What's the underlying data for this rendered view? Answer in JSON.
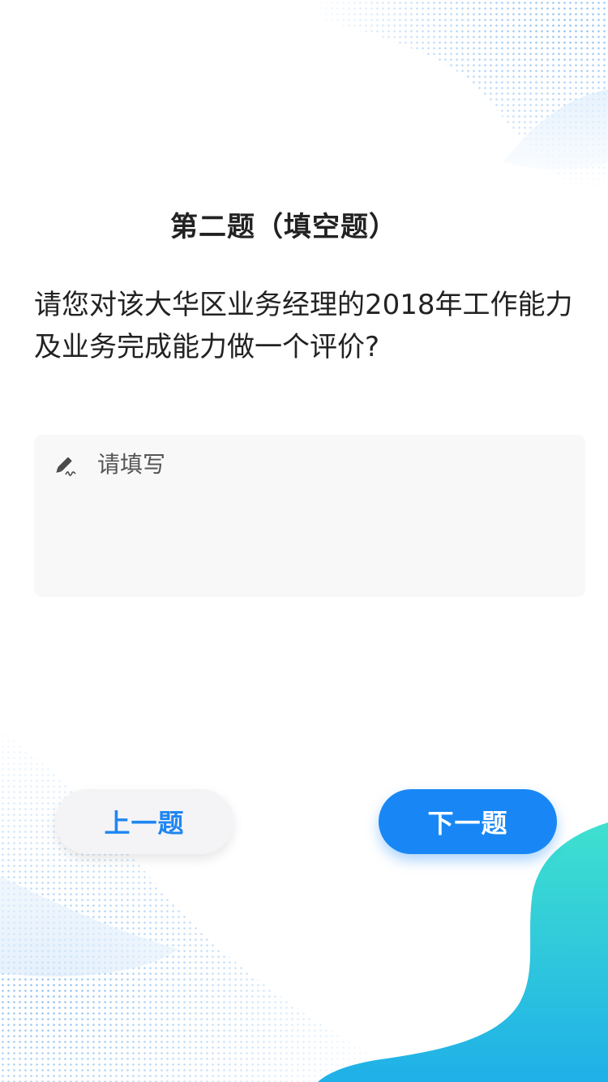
{
  "question": {
    "title": "第二题（填空题）",
    "text": "请您对该大华区业务经理的2018年工作能力及业务完成能力做一个评价?"
  },
  "answer": {
    "placeholder": "请填写",
    "value": "",
    "icon": "pencil-icon"
  },
  "nav": {
    "prev_label": "上一题",
    "next_label": "下一题"
  },
  "colors": {
    "accent": "#1887f5",
    "prev_text": "#1f86f2",
    "wave_top": "#3fe0cf",
    "wave_bottom": "#1fb3e8"
  }
}
